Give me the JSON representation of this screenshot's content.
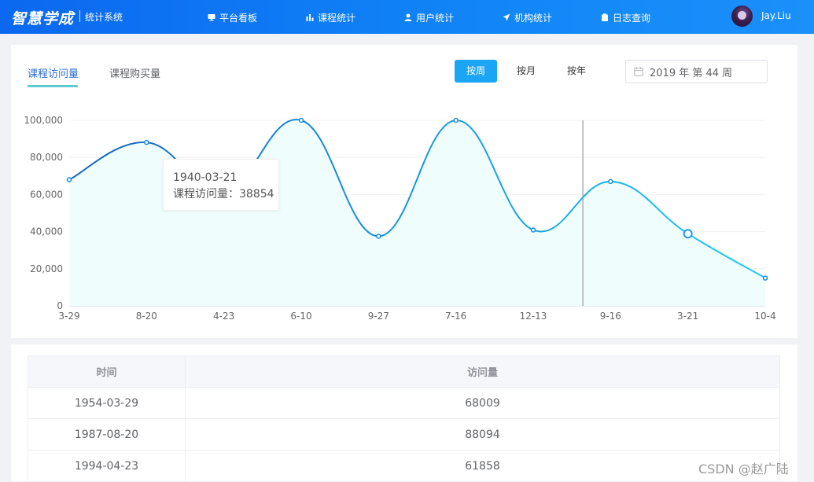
{
  "header": {
    "logo_text": "智慧学成",
    "system_name": "统计系统",
    "nav": [
      {
        "label": "平台看板",
        "icon": "monitor-icon"
      },
      {
        "label": "课程统计",
        "icon": "bar-chart-icon"
      },
      {
        "label": "用户统计",
        "icon": "user-icon"
      },
      {
        "label": "机构统计",
        "icon": "send-icon"
      },
      {
        "label": "日志查询",
        "icon": "clipboard-icon"
      }
    ],
    "username": "Jay.Liu"
  },
  "tabs": [
    {
      "label": "课程访问量",
      "active": true
    },
    {
      "label": "课程购买量",
      "active": false
    }
  ],
  "period_buttons": [
    {
      "label": "按周",
      "active": true
    },
    {
      "label": "按月",
      "active": false
    },
    {
      "label": "按年",
      "active": false
    }
  ],
  "week_picker": {
    "value": "2019 年 第 44 周",
    "icon": "calendar-icon"
  },
  "colors": {
    "accent": "#1ca5f4",
    "line_start": "#1565c0",
    "line_end": "#1ecbf5",
    "area_fill": "#f0fdfd",
    "tab_active": "#2d6cd6"
  },
  "chart_data": {
    "type": "area",
    "x": [
      "3-29",
      "8-20",
      "4-23",
      "6-10",
      "9-27",
      "7-16",
      "12-13",
      "9-16",
      "3-21",
      "10-4"
    ],
    "series": [
      {
        "values": [
          68009,
          88094,
          61858,
          100000,
          37500,
          100000,
          40900,
          67000,
          38854,
          15000
        ]
      }
    ],
    "yticks": [
      0,
      20000,
      40000,
      60000,
      80000,
      100000
    ],
    "ytick_labels": [
      "0",
      "20,000",
      "40,000",
      "60,000",
      "80,000",
      "100,000"
    ],
    "ylim": [
      0,
      100000
    ],
    "grid": true,
    "highlighted_index": 8,
    "tooltip": {
      "date": "1940-03-21",
      "label": "课程访问量：38854"
    }
  },
  "table": {
    "headers": [
      "时间",
      "访问量"
    ],
    "rows": [
      [
        "1954-03-29",
        "68009"
      ],
      [
        "1987-08-20",
        "88094"
      ],
      [
        "1994-04-23",
        "61858"
      ]
    ]
  },
  "watermark": "CSDN @赵广陆"
}
